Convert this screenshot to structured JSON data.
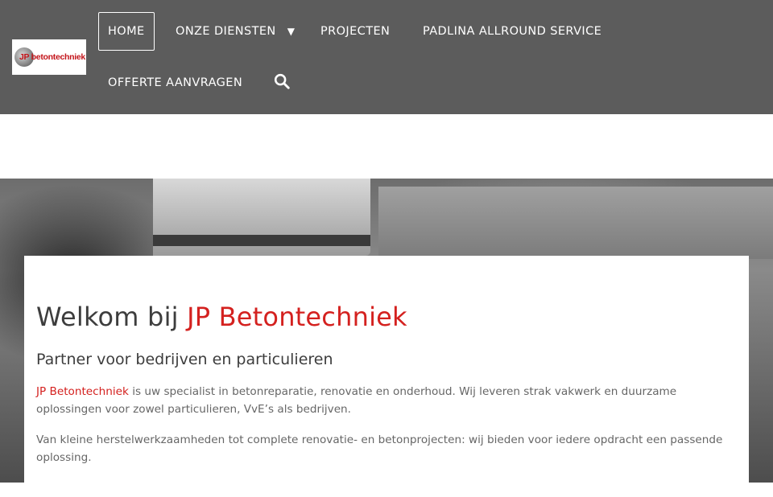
{
  "logo": {
    "text": "JP betontechniek"
  },
  "nav": {
    "items": [
      {
        "label": "HOME",
        "active": true
      },
      {
        "label": "ONZE DIENSTEN",
        "caret": "▼"
      },
      {
        "label": "PROJECTEN"
      },
      {
        "label": "PADLINA ALLROUND SERVICE"
      },
      {
        "label": "OFFERTE AANVRAGEN"
      }
    ],
    "search_icon": "search-icon"
  },
  "main": {
    "heading_prefix": "Welkom bij ",
    "heading_brand": "JP Betontechniek",
    "subheading": "Partner voor bedrijven en particulieren",
    "p1_brand": "JP Betontechniek",
    "p1_rest": " is uw specialist in betonreparatie, renovatie en onderhoud. Wij leveren strak vakwerk en duurzame oplossingen voor zowel particulieren, VvE’s als bedrijven.",
    "p2": "Van kleine herstelwerkzaamheden tot complete renovatie- en betonprojecten: wij bieden voor iedere opdracht een passende oplossing."
  },
  "colors": {
    "header_bg": "#5c5c5c",
    "accent": "#d4211f",
    "text_dark": "#3d3d3d",
    "text_body": "#666666"
  }
}
